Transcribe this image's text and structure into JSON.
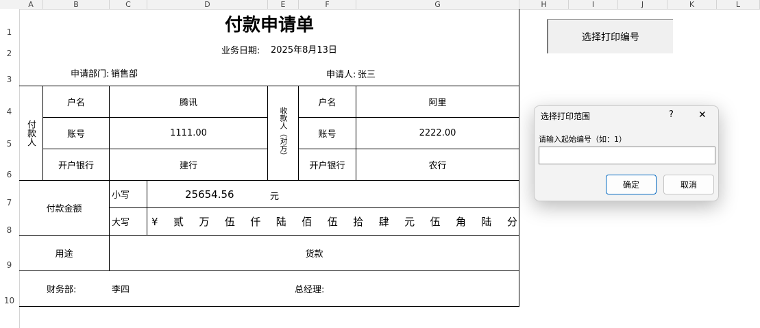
{
  "columns": [
    "A",
    "B",
    "C",
    "D",
    "E",
    "F",
    "G",
    "H",
    "I",
    "J",
    "K",
    "L"
  ],
  "rows": [
    "1",
    "2",
    "3",
    "4",
    "5",
    "6",
    "7",
    "8",
    "9",
    "10"
  ],
  "form": {
    "title": "付款申请单",
    "date_label": "业务日期:",
    "date_value": "2025年8月13日",
    "dept_label": "申请部门:",
    "dept_value": "销售部",
    "applicant_label": "申请人:",
    "applicant_value": "张三",
    "payer_label": "付款人",
    "payee_label": "收款人（对方）",
    "name_label": "户名",
    "account_label": "账号",
    "bank_label": "开户银行",
    "payer_name": "腾讯",
    "payer_account": "1111.00",
    "payer_bank": "建行",
    "payee_name": "阿里",
    "payee_account": "2222.00",
    "payee_bank": "农行",
    "amount_label": "付款金额",
    "small_label": "小写",
    "big_label": "大写",
    "amount_small": "25654.56",
    "yuan_unit": "元",
    "amount_big_chars": [
      "¥",
      "贰",
      "万",
      "伍",
      "仟",
      "陆",
      "佰",
      "伍",
      "拾",
      "肆",
      "元",
      "伍",
      "角",
      "陆",
      "分"
    ],
    "purpose_label": "用途",
    "purpose_value": "货款",
    "finance_label": "财务部:",
    "finance_value": "李四",
    "gm_label": "总经理:"
  },
  "print_button": {
    "label": "选择打印编号"
  },
  "dialog": {
    "title": "选择打印范围",
    "help": "?",
    "close": "✕",
    "prompt": "请输入起始编号（如：1）",
    "input_value": "",
    "ok": "确定",
    "cancel": "取消"
  }
}
